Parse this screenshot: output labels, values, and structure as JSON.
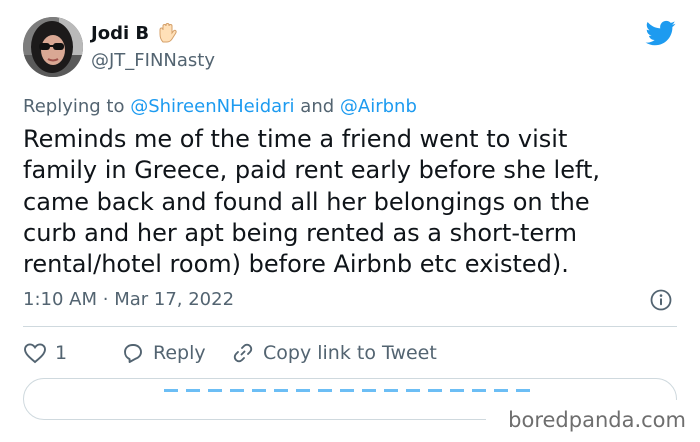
{
  "author": {
    "name": "Jodi B",
    "handle": "@JT_FINNasty",
    "avatar_icon": "profile-photo-sunglasses",
    "emoji_icon": "raised-hand-emoji"
  },
  "brand_icon": "twitter-bird-icon",
  "reply": {
    "prefix": "Replying to",
    "mention_1": "@ShireenNHeidari",
    "joiner": "and",
    "mention_2": "@Airbnb"
  },
  "tweet_text": "Reminds me of the time a friend went to visit\nfamily in Greece, paid rent early before she left,\ncame back and found all her belongings on the\ncurb and her apt being rented as a short-term\nrental/hotel room) before Airbnb etc existed).",
  "timestamp": {
    "time": "1:10 AM",
    "separator": "·",
    "date": "Mar 17, 2022"
  },
  "actions": {
    "like_count": "1",
    "reply_label": "Reply",
    "copy_link_label": "Copy link to Tweet"
  },
  "watermark": "boredpanda.com",
  "colors": {
    "link_blue": "#1d9bf0",
    "secondary_text": "#536471",
    "primary_text": "#0f1419",
    "divider": "#cfd9de"
  }
}
